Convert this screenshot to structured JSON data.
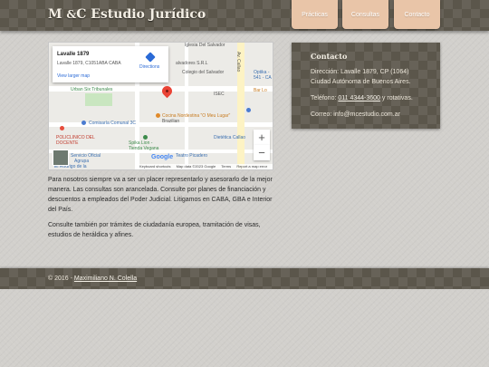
{
  "header": {
    "brand_mc": "M",
    "brand_amp": "&",
    "brand_c": "C",
    "brand_rest": "Estudio Jurídico",
    "nav": [
      "Prácticas",
      "Consultas",
      "Contacto"
    ]
  },
  "map": {
    "card_title": "Lavalle 1879",
    "card_address": "Lavalle 1879, C1051ABA CABA",
    "card_link": "View larger map",
    "directions": "Directions",
    "labels": {
      "iglesia": "Iglesia Del Salvador",
      "alvadores": "alvadores S.R.L",
      "colegio": "Colegio del Salvador",
      "tribunales": "Urban Six Tribunales",
      "optika": "Optika - 541 - CA",
      "bar": "Bar Lo",
      "isec": "ISEC",
      "comisaria": "Comisaría Comunal 3C",
      "cocina": "Cocina Nordestina \"O Meu Lugar\"",
      "brazilian": "Brazilian",
      "policlinico": "POLICLINICO DEL DOCENTE",
      "spika": "Spika Lion - Tienda Vegana",
      "dietetica": "Dietética Callao",
      "servicio": "Servicio Oficial",
      "teatro": "Teatro Picadero",
      "rodrigo": "El Rodrigo de la",
      "callao": "Av. Callao",
      "agrupa": "Agrupa"
    },
    "zoom_in": "+",
    "zoom_out": "−",
    "google": "Google",
    "attribution": [
      "Keyboard shortcuts",
      "Map data ©2023 Google",
      "Terms",
      "Report a map error"
    ]
  },
  "intro": {
    "p1": "Para nosotros siempre va a ser un placer representarlo y asesorarlo de la mejor manera. Las consultas son arancelada. Consulte por planes de financiación y descuentos a empleados del Poder Judicial. Litigamos en CABA, GBA e Interior del País.",
    "p2": "Consulte también por trámites de ciudadanía europea, tramitación de visas, estudios de heráldica y afines."
  },
  "contact": {
    "title": "Contacto",
    "address_line1": "Dirección: Lavalle 1879, CP (1064)",
    "address_line2": "Ciudad Autónoma de Buenos Aires.",
    "phone_label": "Teléfono:",
    "phone_number": "011 4344-3600",
    "phone_suffix": "y rotativas.",
    "email": "Correo: info@mcestudio.com.ar"
  },
  "footer": {
    "copy": "© 2016 -",
    "author": "Maximiliano N. Colella"
  },
  "colors": {
    "band": "#5b564b",
    "nav_button": "#e9c5a8",
    "background": "#d2d0cc"
  }
}
